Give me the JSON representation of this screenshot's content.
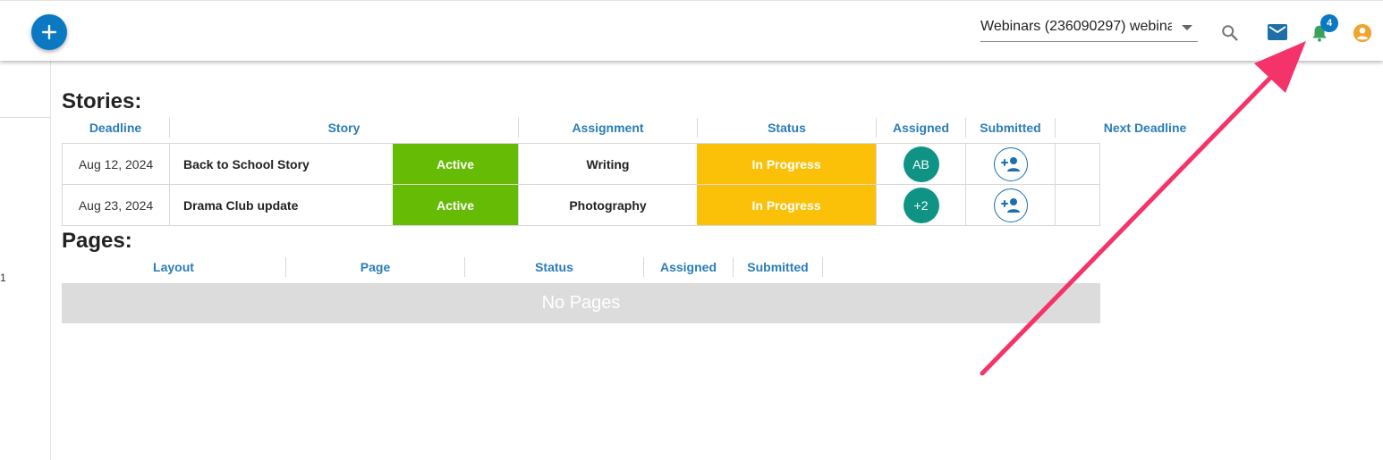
{
  "topbar": {
    "project_select": {
      "value": "Webinars (236090297) webina"
    },
    "notifications": {
      "badge_count": "4"
    },
    "icons": [
      "add-icon",
      "search-icon",
      "mail-icon",
      "bell-icon",
      "account-icon"
    ]
  },
  "sidebar": {
    "item_text": "1"
  },
  "stories": {
    "title": "Stories:",
    "columns": [
      "Deadline",
      "Story",
      "Assignment",
      "Status",
      "Assigned",
      "Submitted",
      "Next Deadline"
    ],
    "rows": [
      {
        "deadline": "Aug 12, 2024",
        "story": "Back to School Story",
        "active": "Active",
        "assignment": "Writing",
        "status": "In Progress",
        "assigned": "AB"
      },
      {
        "deadline": "Aug 23, 2024",
        "story": "Drama Club update",
        "active": "Active",
        "assignment": "Photography",
        "status": "In Progress",
        "assigned": "+2"
      }
    ]
  },
  "pages": {
    "title": "Pages:",
    "columns": [
      "Layout",
      "Page",
      "Status",
      "Assigned",
      "Submitted"
    ],
    "empty_text": "No Pages"
  },
  "colors": {
    "accent": "#0a78c2",
    "header_text": "#2a7db9",
    "active_green": "#66bb05",
    "in_progress_yellow": "#fbc108",
    "avatar_teal": "#0e9384",
    "account_orange": "#f0a430",
    "annotation_arrow": "#f5336b"
  }
}
